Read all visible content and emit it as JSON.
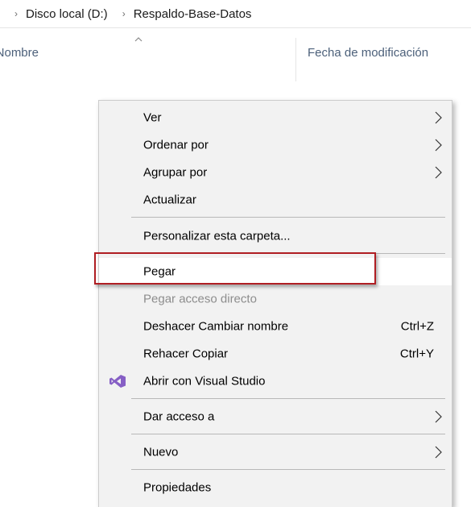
{
  "breadcrumb": {
    "items": [
      "Disco local (D:)",
      "Respaldo-Base-Datos"
    ]
  },
  "columns": {
    "name": "Nombre",
    "date": "Fecha de modificación"
  },
  "menu": {
    "items": [
      {
        "label": "Ver"
      },
      {
        "label": "Ordenar por"
      },
      {
        "label": "Agrupar por"
      },
      {
        "label": "Actualizar"
      },
      {
        "label": "Personalizar esta carpeta..."
      },
      {
        "label": "Pegar"
      },
      {
        "label": "Pegar acceso directo"
      },
      {
        "label": "Deshacer Cambiar nombre",
        "shortcut": "Ctrl+Z"
      },
      {
        "label": "Rehacer Copiar",
        "shortcut": "Ctrl+Y"
      },
      {
        "label": "Abrir con Visual Studio"
      },
      {
        "label": "Dar acceso a"
      },
      {
        "label": "Nuevo"
      },
      {
        "label": "Propiedades"
      }
    ]
  },
  "colors": {
    "highlight_box": "#b01e23",
    "visual_studio": "#865fc5",
    "header_text": "#4c607a"
  }
}
